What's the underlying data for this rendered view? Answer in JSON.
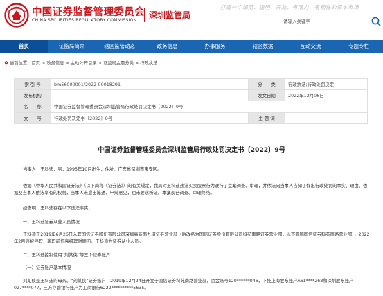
{
  "header": {
    "org_cn": "中国证券监督管理委员会",
    "org_en": "CHINA SECURITIES REGULATORY COMMISSION",
    "bureau": "深圳监管局",
    "slogan": "打造一个规范、透明、开放、有活力、有韧性的资本市场",
    "search_placeholder": "请输入关键字",
    "brand_color": "#c8161d"
  },
  "nav": {
    "color": "#1b66b3",
    "items": [
      "首页",
      "证监局简介",
      "辖区监管动态",
      "政务信息",
      "办事服务",
      "辖区数据",
      "互动交流",
      "专题专栏"
    ],
    "active_index": 0
  },
  "breadcrumb": {
    "prefix": "当前位置：",
    "text": "首页 > 政务信息 > 主动公开目录 > 证监局主题分类 > 行政执法"
  },
  "info_table": {
    "index_label": "索 引 号",
    "index_value": "bm56000001/2022-00018291",
    "category_label": "分　　类",
    "category_value": "行政执法;行政处罚决定",
    "publisher_label": "发布机构",
    "publisher_value": "",
    "date_label": "发文日期",
    "date_value": "2022年12月06日",
    "name_label": "名　　称",
    "name_value": "中国证券监督管理委员会深圳监管局行政处罚决定书〔2022〕9号",
    "doc_no_label": "文　　号",
    "doc_no_value": "行政处罚决定书〔2022〕9号",
    "keyword_label": "主 题 词",
    "keyword_value": ""
  },
  "document": {
    "title": "中国证券监督管理委员会深圳监管局行政处罚决定书〔2022〕9号",
    "paragraphs": [
      "当事人：王科迪，男，1995年10月出生，住址：广东省深圳市宝安区。",
      "依据《中华人民共和国证券法》（以下简称《证券法》）的有关规定，我局对王科迪违法买卖股票行为进行了立案调查、审理，并依法向当事人告知了作出行政处罚的事实、理由、依据及当事人依法享有的权利，当事人未提出陈述、申辩意见，也未要求听证。本案现已调查、审理终结。",
      "经查明，王科迪存在以下违法事实：",
      "一、王科迪证券从业人员情况",
      "王科迪于2019年6月26日入职国信证券股份有限公司深圳高新南九道证券营业部（后改名为国信证券股份有限公司科苑南路证券营业部，以下简称国信证券科苑南路营业部），2022年2月底被停职，离职前任高级理财顾问。王科迪为证券从业人员。",
      "二、王科迪控制使用“刘某侠”等三个证券账户",
      "（一）证券账户基本情况",
      "刘某侠是王科迪的母亲。“刘某侠”证券账户，2019年12月24日开立于国信证券科苑南路营业部，资金账号120******046，下挂上海股东账户A61****268和深圳股东账户027****077，三方存管银行账户为工商银行6222**********5635。"
    ]
  }
}
